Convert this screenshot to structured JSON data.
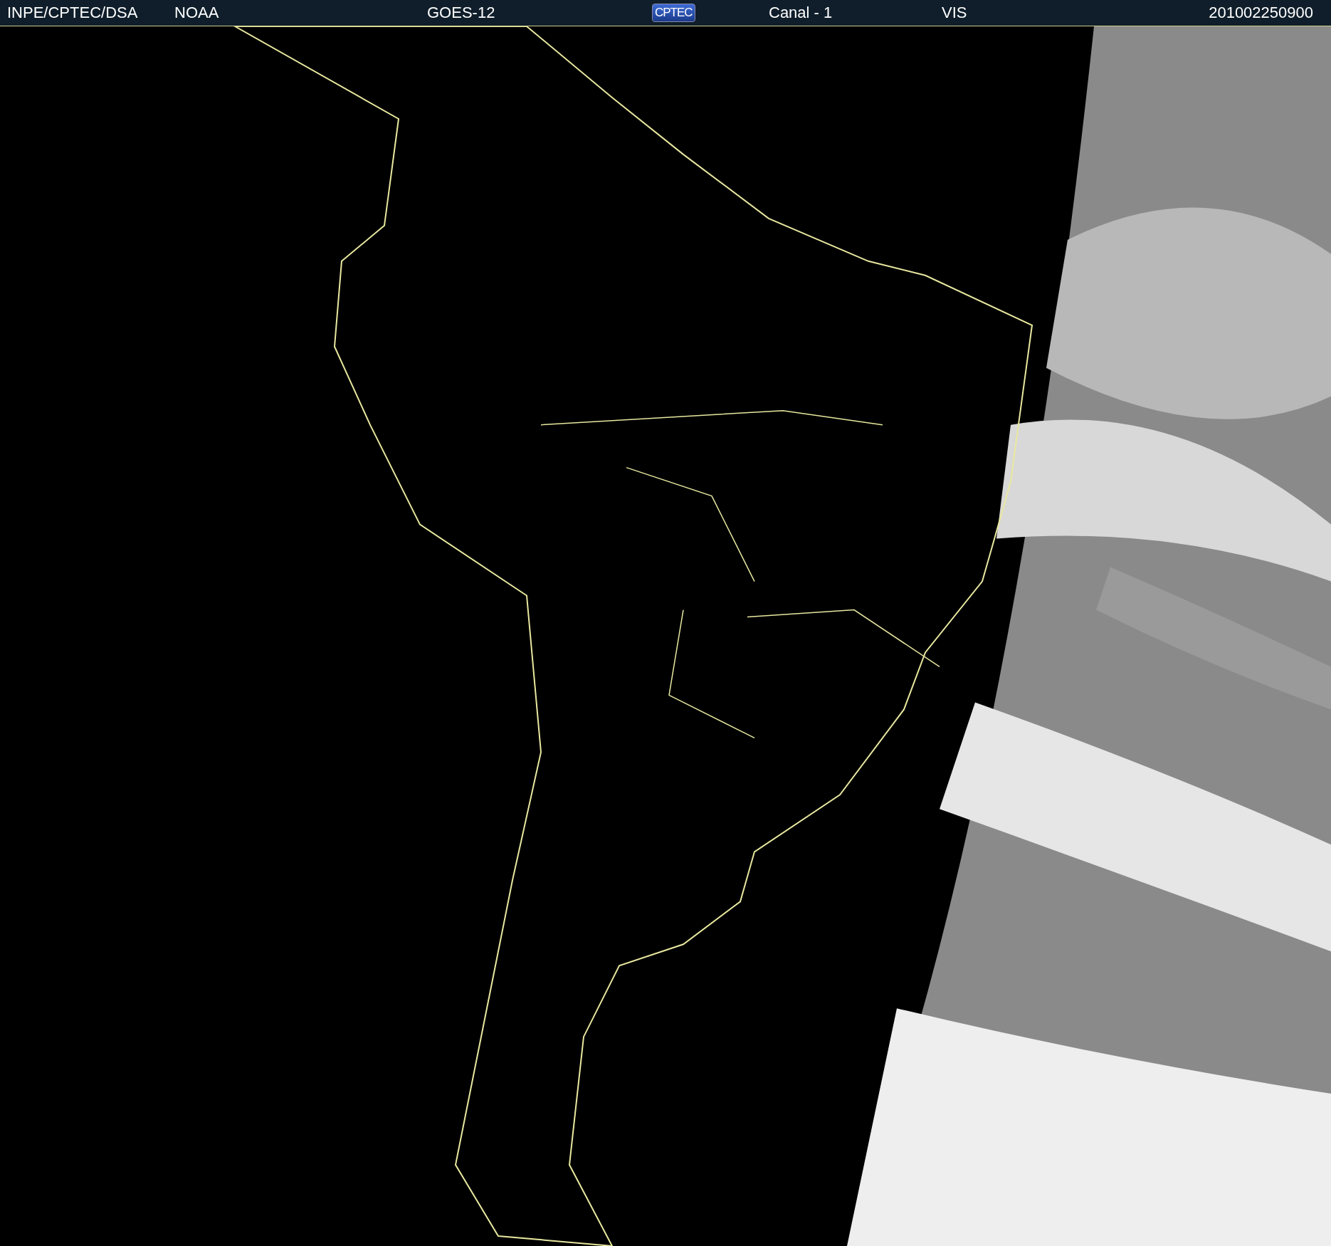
{
  "header": {
    "items": [
      {
        "kind": "text",
        "text": "INPE/CPTEC/DSA"
      },
      {
        "kind": "text",
        "text": "NOAA"
      },
      {
        "kind": "text",
        "text": "GOES-12"
      },
      {
        "kind": "logo",
        "text": "CPTEC"
      },
      {
        "kind": "text",
        "text": "Canal - 1"
      },
      {
        "kind": "text",
        "text": "VIS"
      },
      {
        "kind": "text",
        "text": "201002250900"
      }
    ]
  }
}
